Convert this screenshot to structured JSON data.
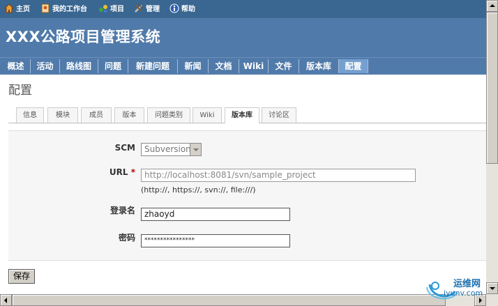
{
  "top_menu": [
    {
      "label": "主页",
      "icon": "home-icon"
    },
    {
      "label": "我的工作台",
      "icon": "page-icon"
    },
    {
      "label": "项目",
      "icon": "projects-icon"
    },
    {
      "label": "管理",
      "icon": "tools-icon"
    },
    {
      "label": "帮助",
      "icon": "help-icon"
    }
  ],
  "site_title": "XXX公路项目管理系统",
  "main_menu": [
    "概述",
    "活动",
    "路线图",
    "问题",
    "新建问题",
    "新闻",
    "文档",
    "Wiki",
    "文件",
    "版本库",
    "配置"
  ],
  "main_menu_selected": "配置",
  "page_title": "配置",
  "tabs": [
    "信息",
    "模块",
    "成员",
    "版本",
    "问题类别",
    "Wiki",
    "版本库",
    "讨论区"
  ],
  "tabs_selected": "版本库",
  "form": {
    "scm_label": "SCM",
    "scm_value": "Subversion",
    "url_label": "URL",
    "url_required": "*",
    "url_value": "http://localhost:8081/svn/sample_project",
    "url_hint": "(http://, https://, svn://, file:///)",
    "login_label": "登录名",
    "login_value": "zhaoyd",
    "password_label": "密码",
    "password_value": "****************"
  },
  "save_label": "保存",
  "watermark": {
    "text": "运维网",
    "url": "iyunv.com"
  },
  "colors": {
    "top_bar": "#3a6791",
    "header": "#507aaa",
    "selected_menu": "#759fcf",
    "required": "#bb0000"
  }
}
